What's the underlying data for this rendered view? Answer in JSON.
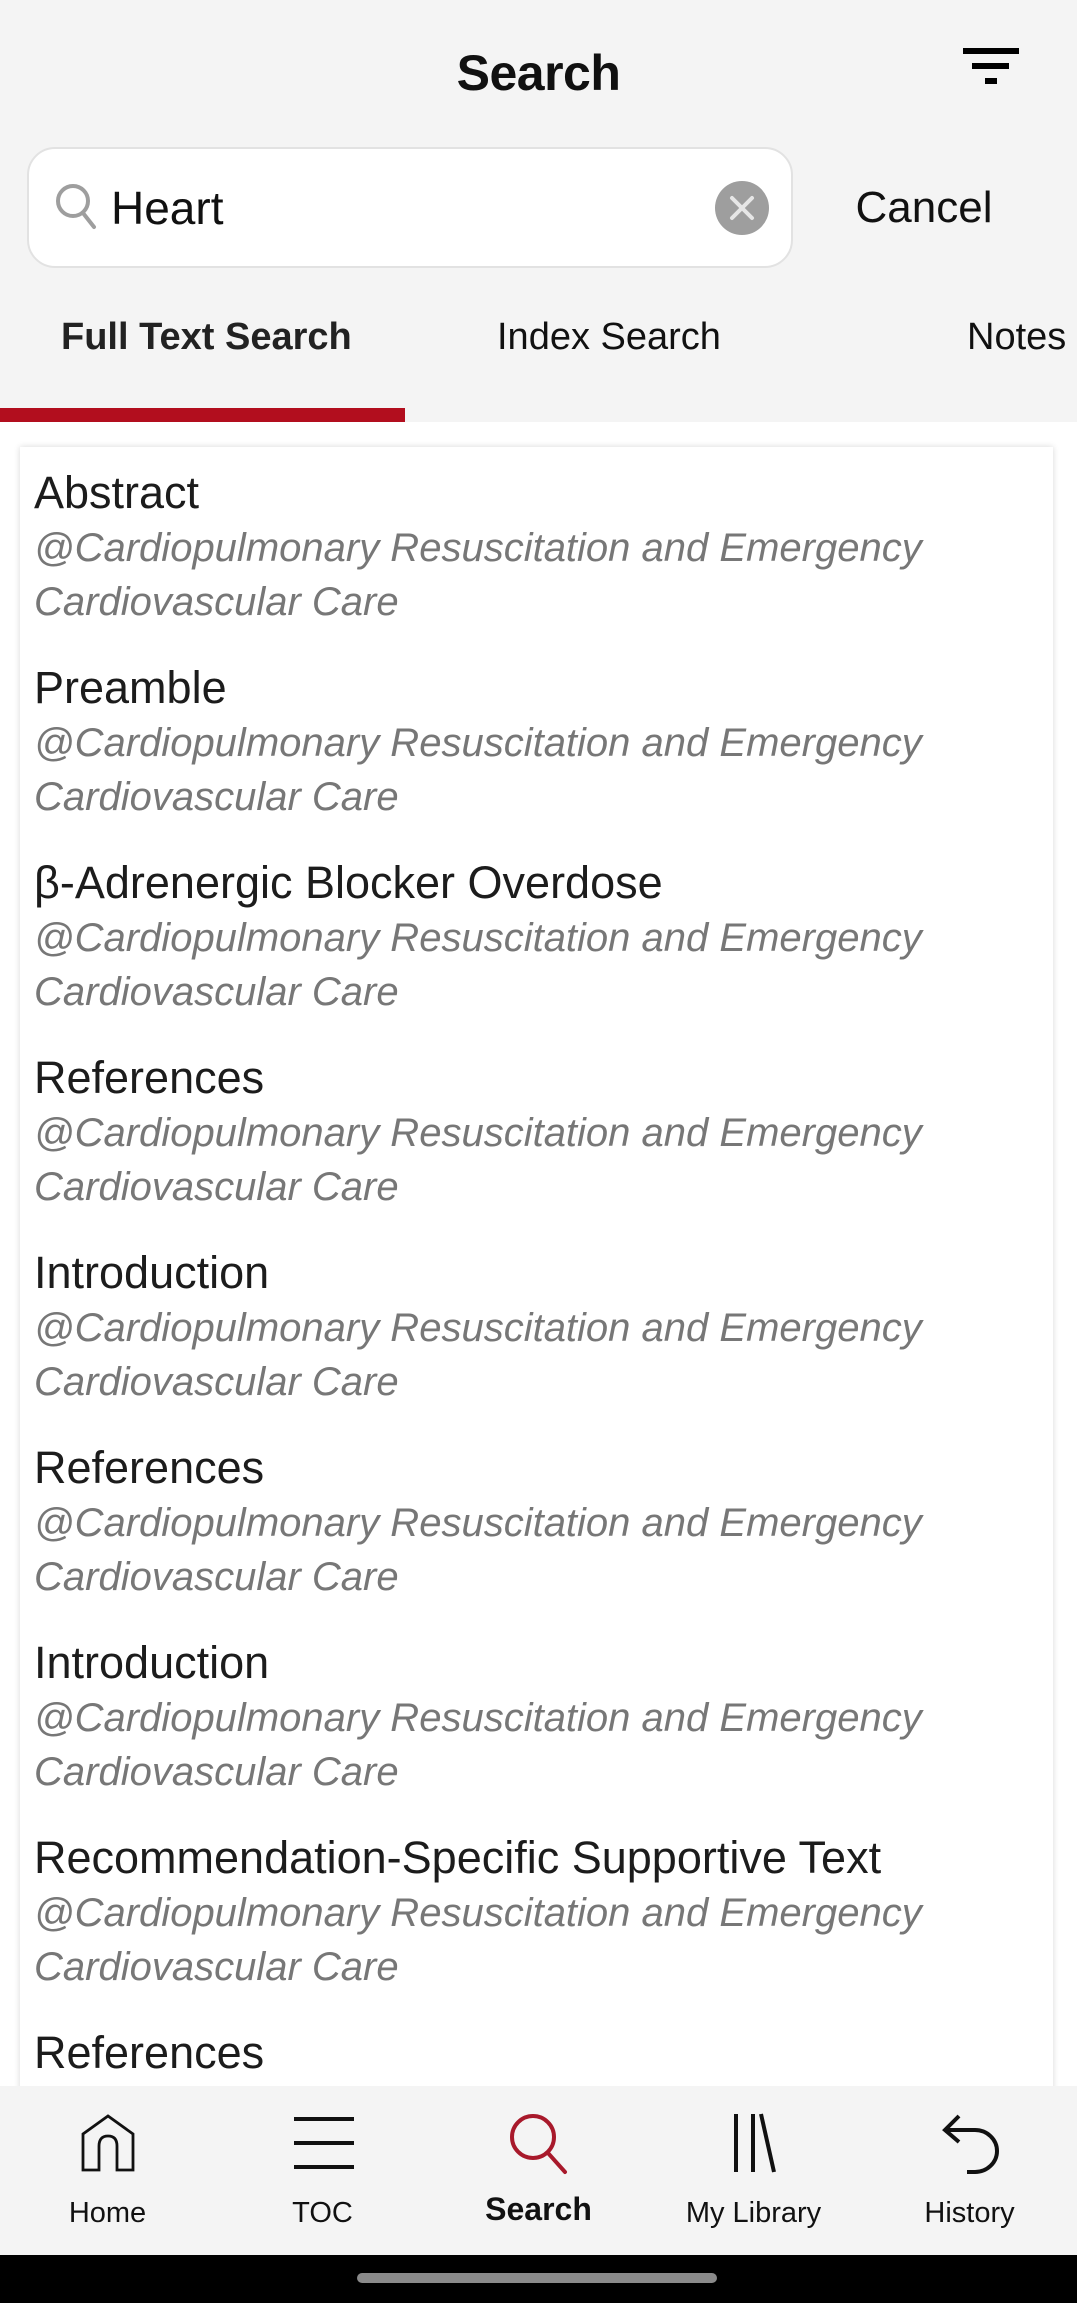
{
  "header": {
    "title": "Search",
    "filter_icon": "filter-icon"
  },
  "search": {
    "value": "Heart",
    "search_icon": "search-icon",
    "clear_icon": "clear-circle-icon",
    "cancel_label": "Cancel"
  },
  "tabs": [
    {
      "label": "Full Text Search",
      "active": true
    },
    {
      "label": "Index Search",
      "active": false
    },
    {
      "label": "Notes",
      "active": false
    }
  ],
  "colors": {
    "accent": "#b20e1e",
    "subtitle": "#777777",
    "background": "#f4f4f4",
    "clear_button": "#9e9e9e"
  },
  "results": [
    {
      "title": "Abstract",
      "source": "@Cardiopulmonary Resuscitation and Emergency Cardiovascular Care"
    },
    {
      "title": "Preamble",
      "source": "@Cardiopulmonary Resuscitation and Emergency Cardiovascular Care"
    },
    {
      "title": "β-Adrenergic Blocker Overdose",
      "source": "@Cardiopulmonary Resuscitation and Emergency Cardiovascular Care"
    },
    {
      "title": "References",
      "source": "@Cardiopulmonary Resuscitation and Emergency Cardiovascular Care"
    },
    {
      "title": "Introduction",
      "source": "@Cardiopulmonary Resuscitation and Emergency Cardiovascular Care"
    },
    {
      "title": "References",
      "source": "@Cardiopulmonary Resuscitation and Emergency Cardiovascular Care"
    },
    {
      "title": "Introduction",
      "source": "@Cardiopulmonary Resuscitation and Emergency Cardiovascular Care"
    },
    {
      "title": "Recommendation-Specific Supportive Text",
      "source": "@Cardiopulmonary Resuscitation and Emergency Cardiovascular Care"
    },
    {
      "title": "References",
      "source": ""
    }
  ],
  "bottom_nav": [
    {
      "label": "Home",
      "icon": "home-icon",
      "active": false
    },
    {
      "label": "TOC",
      "icon": "menu-icon",
      "active": false
    },
    {
      "label": "Search",
      "icon": "search-icon",
      "active": true
    },
    {
      "label": "My Library",
      "icon": "library-icon",
      "active": false
    },
    {
      "label": "History",
      "icon": "history-icon",
      "active": false
    }
  ]
}
